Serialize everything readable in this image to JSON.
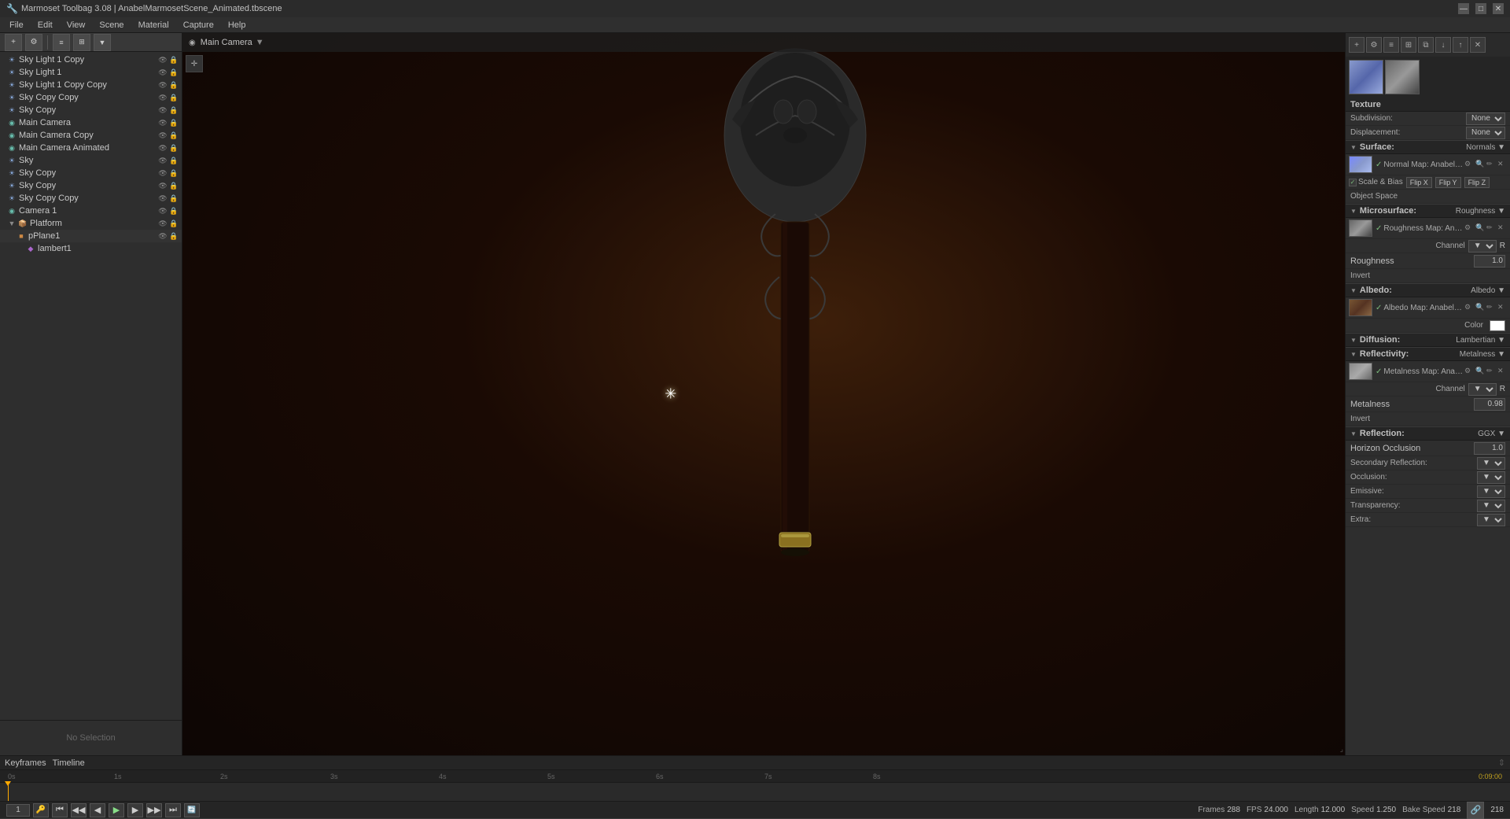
{
  "window": {
    "title": "Marmoset Toolbag 3.08 | AnabelMarmosetScene_Animated.tbscene",
    "minimize": "—",
    "maximize": "□",
    "close": "✕"
  },
  "menu": {
    "items": [
      "File",
      "Edit",
      "View",
      "Scene",
      "Material",
      "Capture",
      "Help"
    ]
  },
  "viewport": {
    "camera_label": "Main Camera",
    "camera_arrow": "▼"
  },
  "scene_tree": {
    "items": [
      {
        "id": 1,
        "label": "Sky Light 1 Copy",
        "icon": "☀",
        "icon_class": "icon-sky",
        "indent": 0
      },
      {
        "id": 2,
        "label": "Sky Light 1",
        "icon": "☀",
        "icon_class": "icon-sky",
        "indent": 0
      },
      {
        "id": 3,
        "label": "Sky Light 1 Copy Copy",
        "icon": "☀",
        "icon_class": "icon-sky",
        "indent": 0
      },
      {
        "id": 4,
        "label": "Sky Copy Copy",
        "icon": "☀",
        "icon_class": "icon-sky",
        "indent": 0
      },
      {
        "id": 5,
        "label": "Sky Copy",
        "icon": "☀",
        "icon_class": "icon-sky",
        "indent": 0
      },
      {
        "id": 6,
        "label": "Main Camera",
        "icon": "📷",
        "icon_class": "icon-camera",
        "indent": 0
      },
      {
        "id": 7,
        "label": "Main Camera Copy",
        "icon": "📷",
        "icon_class": "icon-camera",
        "indent": 0
      },
      {
        "id": 8,
        "label": "Main Camera Animated",
        "icon": "📷",
        "icon_class": "icon-camera",
        "indent": 0
      },
      {
        "id": 9,
        "label": "Sky",
        "icon": "☀",
        "icon_class": "icon-sky",
        "indent": 0
      },
      {
        "id": 10,
        "label": "Sky Copy",
        "icon": "☀",
        "icon_class": "icon-sky",
        "indent": 0
      },
      {
        "id": 11,
        "label": "Sky Copy",
        "icon": "☀",
        "icon_class": "icon-sky",
        "indent": 0
      },
      {
        "id": 12,
        "label": "Sky Copy Copy",
        "icon": "☀",
        "icon_class": "icon-sky",
        "indent": 0
      },
      {
        "id": 13,
        "label": "Camera 1",
        "icon": "📷",
        "icon_class": "icon-camera",
        "indent": 0
      },
      {
        "id": 14,
        "label": "Platform",
        "icon": "▶",
        "icon_class": "icon-folder",
        "indent": 0
      },
      {
        "id": 15,
        "label": "pPlane1",
        "icon": "■",
        "icon_class": "icon-mesh",
        "indent": 1
      },
      {
        "id": 16,
        "label": "lambert1",
        "icon": "◆",
        "icon_class": "icon-material",
        "indent": 2
      }
    ],
    "no_selection": "No Selection"
  },
  "properties": {
    "texture_section": "Texture",
    "subdivision_label": "Subdivision:",
    "displacement_label": "Displacement:",
    "surface_section": "Surface:",
    "surface_value": "Normals ▼",
    "normal_map_check": "✓",
    "normal_map_label": "Normal Map:",
    "normal_map_name": "Anabel_Cane_ForBake_Car",
    "scale_bias_label": "Scale & Bias",
    "flip_x": "Flip X",
    "flip_y": "Flip Y",
    "flip_z": "Flip Z",
    "object_space": "Object Space",
    "microsurface_section": "Microsurface:",
    "microsurface_value": "Roughness ▼",
    "roughness_map_check": "✓",
    "roughness_map_label": "Roughness Map:",
    "roughness_map_name": "Anabel_Cane_ForBake_",
    "channel_label": "Channel",
    "channel_value": "R",
    "roughness_label": "Roughness",
    "roughness_value": "1.0",
    "invert_label": "Invert",
    "albedo_section": "Albedo:",
    "albedo_value": "Albedo ▼",
    "albedo_map_check": "✓",
    "albedo_map_label": "Albedo Map:",
    "albedo_map_name": "Anabel_Cane_ForBake_Can",
    "color_label": "Color",
    "diffusion_section": "Diffusion:",
    "diffusion_value": "Lambertian ▼",
    "reflectivity_section": "Reflectivity:",
    "reflectivity_value": "Metalness ▼",
    "metalness_map_check": "✓",
    "metalness_map_label": "Metalness Map:",
    "metalness_map_name": "Anabel_Cane_ForBake_C",
    "metalness_channel_label": "Channel",
    "metalness_channel_value": "R",
    "metalness_label": "Metalness",
    "metalness_value": "0.98",
    "metalness_invert": "Invert",
    "reflection_section": "Reflection:",
    "reflection_value": "GGX ▼",
    "horizon_occlusion_label": "Horizon Occlusion",
    "horizon_occlusion_value": "1.0",
    "secondary_reflection": "Secondary Reflection:",
    "occlusion": "Occlusion:",
    "emissive": "Emissive:",
    "transparency": "Transparency:",
    "extra": "Extra:"
  },
  "timeline": {
    "keyframes_label": "Keyframes",
    "timeline_label": "Timeline",
    "ruler_marks": [
      "0s",
      "1s",
      "2s",
      "3s",
      "4s",
      "5s",
      "6s",
      "7s",
      "8s"
    ],
    "current_time": "0:09:00",
    "current_frame": "1",
    "frames_label": "Frames",
    "frames_value": "288",
    "fps_label": "FPS",
    "fps_value": "24.000",
    "length_label": "Length",
    "length_value": "12.000",
    "speed_label": "Speed",
    "speed_value": "1.250",
    "bake_speed_label": "Bake Speed",
    "bake_speed_value": "218",
    "controls": {
      "to_start": "⏮",
      "prev_frame": "◀",
      "prev": "◀",
      "play": "▶",
      "next": "▶",
      "to_end": "⏭"
    }
  }
}
